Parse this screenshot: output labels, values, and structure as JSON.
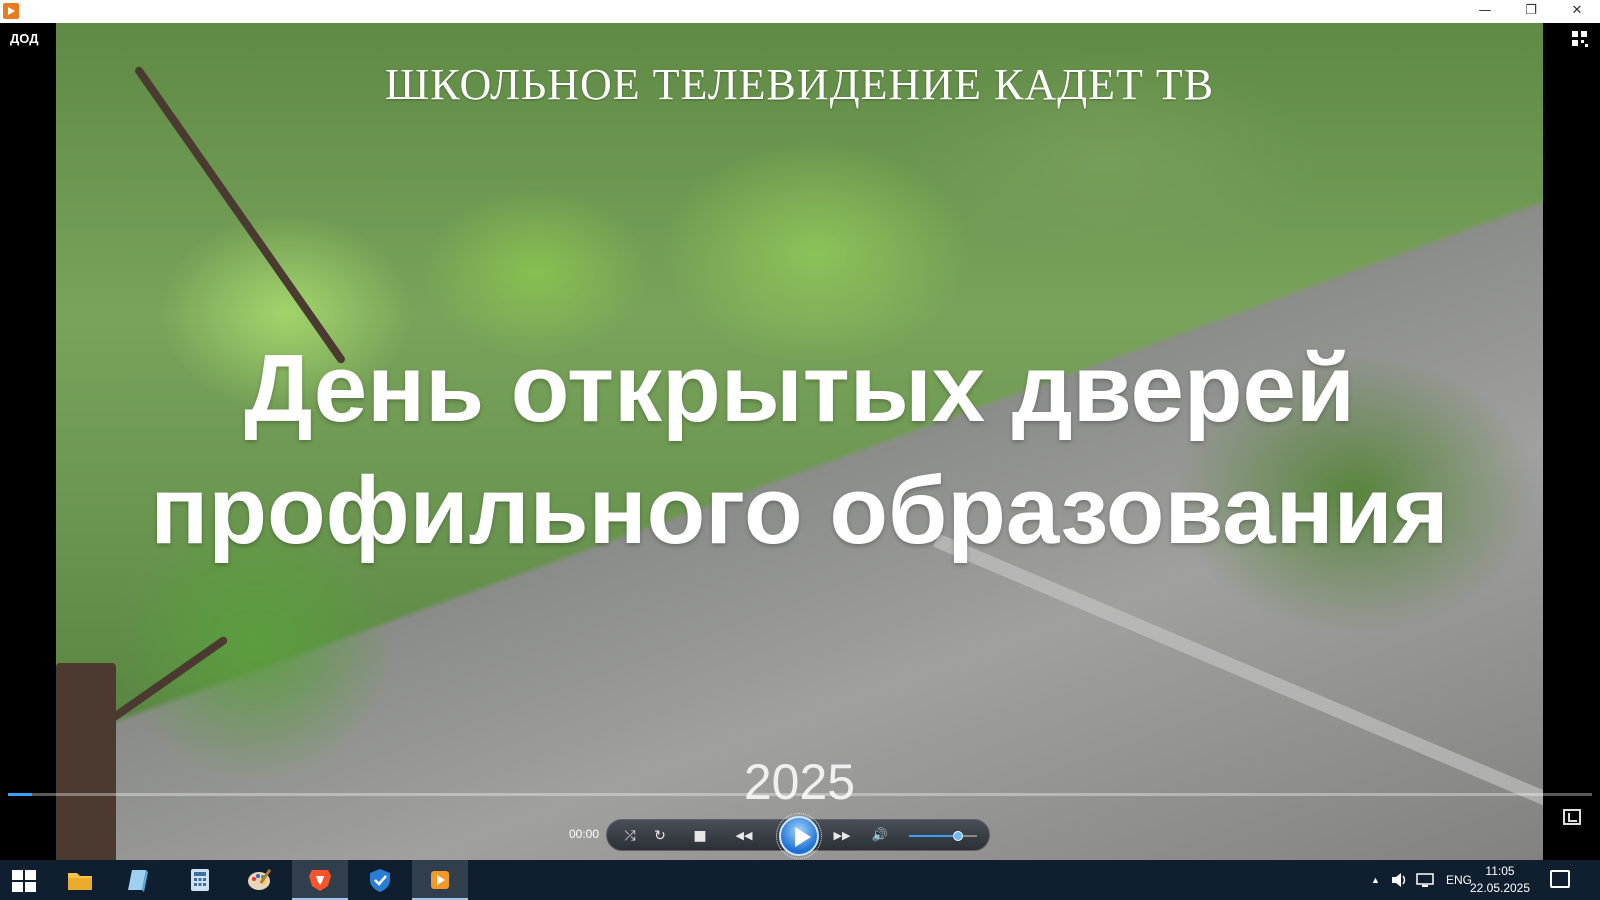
{
  "window": {
    "controls": {
      "minimize": "—",
      "maximize": "❐",
      "close": "✕"
    }
  },
  "player": {
    "file_label": "ДОД",
    "video_heading": "ШКОЛЬНОЕ ТЕЛЕВИДЕНИЕ КАДЕТ ТВ",
    "video_title_line1": "День открытых дверей",
    "video_title_line2": "профильного образования",
    "video_year": "2025",
    "current_time": "00:00",
    "progress": 0.015,
    "volume": 0.72
  },
  "controls": {
    "shuffle": "⤮",
    "repeat": "↻",
    "stop": "■",
    "previous": "◀◀",
    "next": "▶▶",
    "volume": "🔊"
  },
  "taskbar": {
    "language": "ENG",
    "time": "11:05",
    "date": "22.05.2025",
    "tray_up_arrow": "▲",
    "colors": {
      "background": "#101f2f",
      "accent": "#3aa0ff"
    }
  }
}
